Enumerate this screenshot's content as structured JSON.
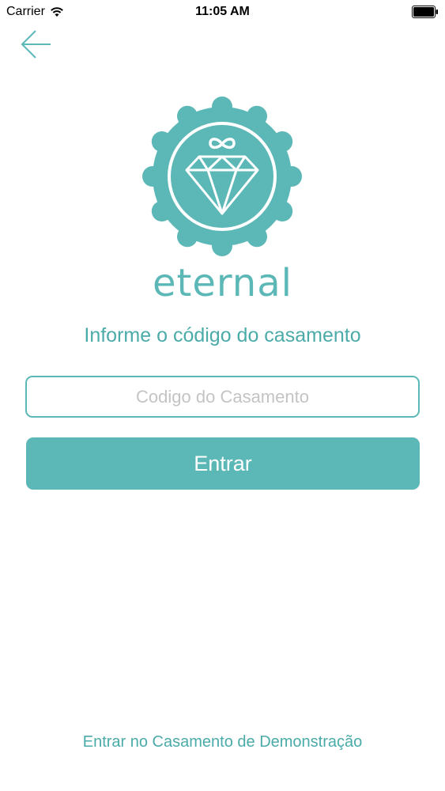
{
  "status_bar": {
    "carrier": "Carrier",
    "time": "11:05 AM",
    "wifi_icon": "wifi-icon",
    "battery_icon": "battery-icon"
  },
  "nav": {
    "back_icon": "arrow-left-icon"
  },
  "brand": {
    "name": "eternal",
    "logo_icon": "diamond-infinity-badge-icon",
    "accent_color": "#5cb8b7"
  },
  "form": {
    "instruction": "Informe o código do casamento",
    "code_placeholder": "Codigo do Casamento",
    "code_value": "",
    "submit_label": "Entrar"
  },
  "footer": {
    "demo_link": "Entrar no Casamento de Demonstração"
  }
}
